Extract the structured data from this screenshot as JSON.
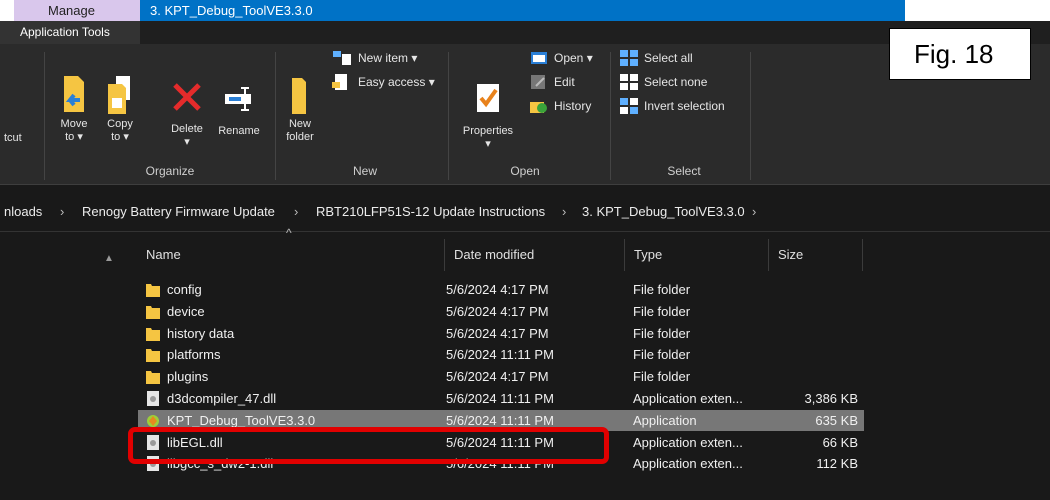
{
  "titlebar": {
    "manage_tab": "Manage",
    "title": "3. KPT_Debug_ToolVE3.3.0",
    "app_tools_tab": "Application Tools"
  },
  "figure_label": "Fig. 18",
  "ribbon": {
    "clip_label": "tcut",
    "organize": {
      "move_to": "Move",
      "move_to2": "to ▾",
      "copy_to": "Copy",
      "copy_to2": "to ▾",
      "delete": "Delete",
      "rename": "Rename",
      "group": "Organize"
    },
    "new": {
      "new_item": "New item ▾",
      "easy_access": "Easy access ▾",
      "new_folder": "New",
      "new_folder2": "folder",
      "group": "New"
    },
    "open": {
      "properties": "Properties",
      "open": "Open ▾",
      "edit": "Edit",
      "history": "History",
      "group": "Open"
    },
    "select": {
      "select_all": "Select all",
      "select_none": "Select none",
      "invert_selection": "Invert selection",
      "group": "Select"
    }
  },
  "address": {
    "crumbs": [
      "nloads",
      "Renogy Battery Firmware Update",
      "RBT210LFP51S-12 Update Instructions",
      "3. KPT_Debug_ToolVE3.3.0"
    ],
    "separator": "›"
  },
  "columns": {
    "name": "Name",
    "date": "Date modified",
    "type": "Type",
    "size": "Size"
  },
  "files": [
    {
      "name": "config",
      "date": "5/6/2024 4:17 PM",
      "type": "File folder",
      "size": "",
      "icon": "folder-icon"
    },
    {
      "name": "device",
      "date": "5/6/2024 4:17 PM",
      "type": "File folder",
      "size": "",
      "icon": "folder-icon"
    },
    {
      "name": "history data",
      "date": "5/6/2024 4:17 PM",
      "type": "File folder",
      "size": "",
      "icon": "folder-icon"
    },
    {
      "name": "platforms",
      "date": "5/6/2024 11:11 PM",
      "type": "File folder",
      "size": "",
      "icon": "folder-icon"
    },
    {
      "name": "plugins",
      "date": "5/6/2024 4:17 PM",
      "type": "File folder",
      "size": "",
      "icon": "folder-icon"
    },
    {
      "name": "d3dcompiler_47.dll",
      "date": "5/6/2024 11:11 PM",
      "type": "Application exten...",
      "size": "3,386 KB",
      "icon": "dll-file-icon"
    },
    {
      "name": "KPT_Debug_ToolVE3.3.0",
      "date": "5/6/2024 11:11 PM",
      "type": "Application",
      "size": "635 KB",
      "icon": "application-icon",
      "selected": true
    },
    {
      "name": "libEGL.dll",
      "date": "5/6/2024 11:11 PM",
      "type": "Application exten...",
      "size": "66 KB",
      "icon": "dll-file-icon"
    },
    {
      "name": "libgcc_s_dw2-1.dll",
      "date": "5/6/2024 11:11 PM",
      "type": "Application exten...",
      "size": "112 KB",
      "icon": "dll-file-icon"
    }
  ],
  "colors": {
    "title_blue": "#0072c6",
    "manage_purple": "#d9c7ec",
    "highlight_red": "#e10000",
    "selected_row": "#777777"
  }
}
